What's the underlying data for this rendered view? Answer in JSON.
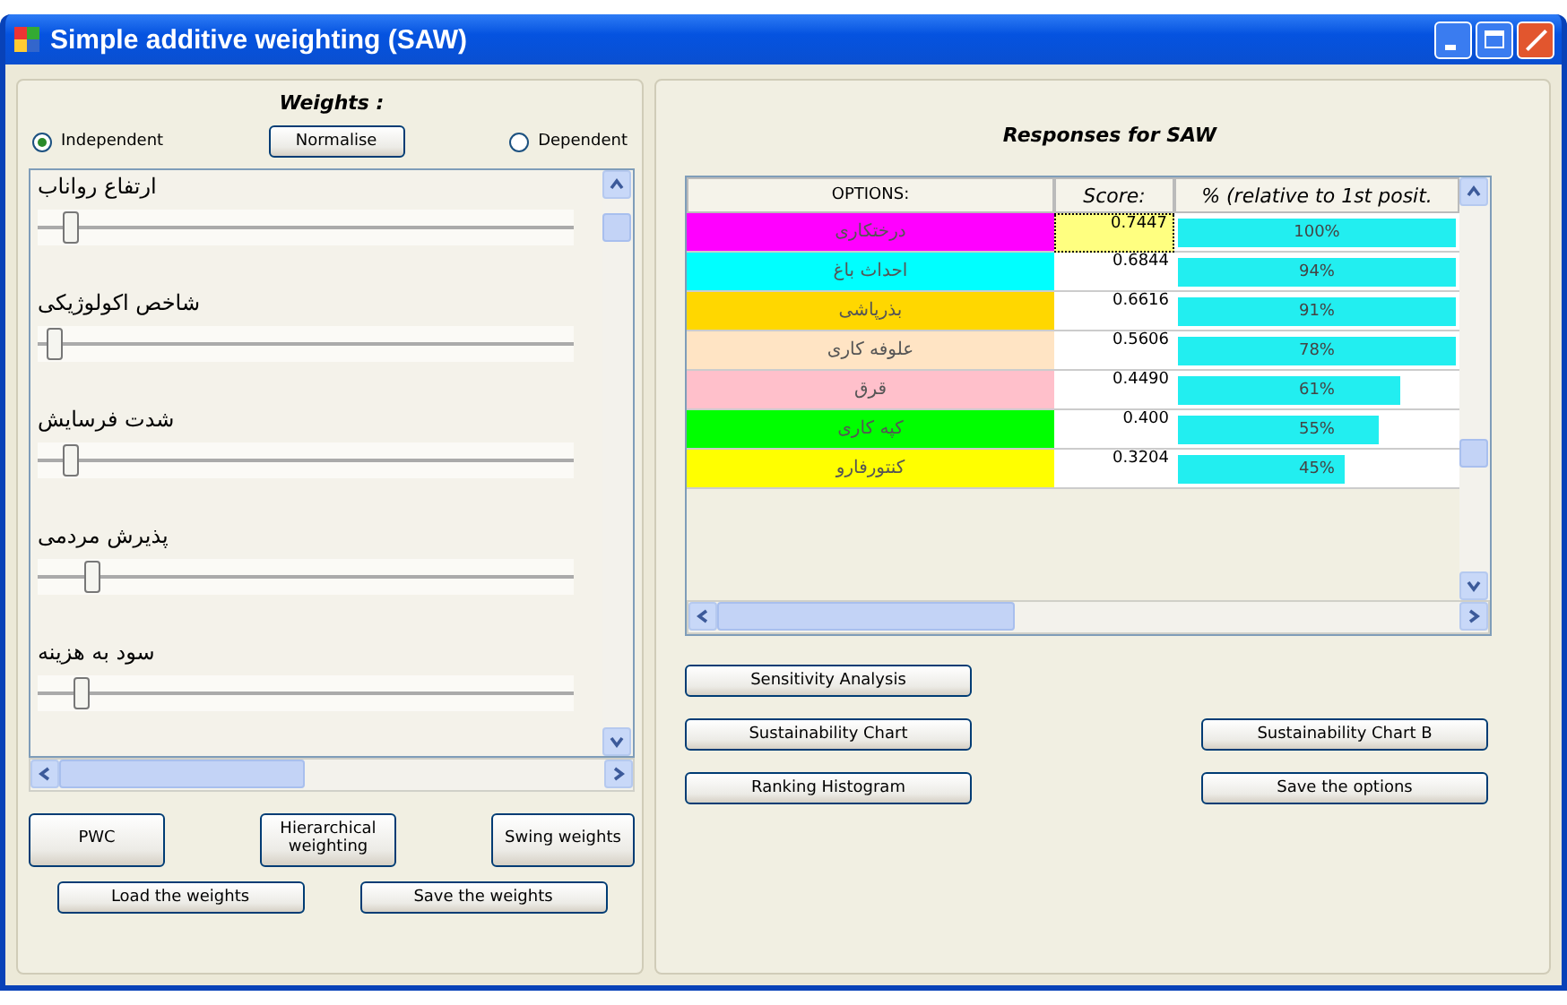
{
  "window": {
    "title": "Simple additive weighting (SAW)"
  },
  "weights": {
    "title": "Weights :",
    "modes": [
      {
        "label": "Independent",
        "selected": true
      },
      {
        "label": "Dependent",
        "selected": false
      }
    ],
    "normalise_button": "Normalise",
    "criteria": [
      {
        "label": "ارتفاع رواناب",
        "level": 0.06
      },
      {
        "label": "شاخص اکولوژیکی",
        "level": 0.03
      },
      {
        "label": "شدت فرسایش",
        "level": 0.06
      },
      {
        "label": "پذیرش مردمی",
        "level": 0.1
      },
      {
        "label": "سود به هزینه",
        "level": 0.08
      }
    ],
    "buttons": [
      "PWC",
      "Hierarchical weighting",
      "Swing weights"
    ],
    "file_buttons": [
      "Load the weights",
      "Save the weights"
    ]
  },
  "responses": {
    "title": "Responses for SAW",
    "table": {
      "columns": [
        "OPTIONS:",
        "Score:",
        "% (relative to 1st posit."
      ],
      "rows": [
        {
          "option": "درختکاری",
          "color": "#ff00ff",
          "score": "0.7447",
          "focused": true,
          "percent": "100%",
          "level": 1
        },
        {
          "option": "احداث باغ",
          "color": "#00ffff",
          "score": "0.6844",
          "focused": false,
          "percent": "94%",
          "level": 1
        },
        {
          "option": "بذرپاشی",
          "color": "#ffd700",
          "score": "0.6616",
          "focused": false,
          "percent": "91%",
          "level": 1
        },
        {
          "option": "علوفه کاری",
          "color": "#ffe4c4",
          "score": "0.5606",
          "focused": false,
          "percent": "78%",
          "level": 1
        },
        {
          "option": "قرق",
          "color": "#ffc0cb",
          "score": "0.4490",
          "focused": false,
          "percent": "61%",
          "level": 0.8
        },
        {
          "option": "کپه کاری",
          "color": "#00ff00",
          "score": "0.400",
          "focused": false,
          "percent": "55%",
          "level": 0.72
        },
        {
          "option": "کنتورفارو",
          "color": "#ffff00",
          "score": "0.3204",
          "focused": false,
          "percent": "45%",
          "level": 0.6
        }
      ]
    },
    "button_rows": [
      [
        "Sensitivity Analysis"
      ],
      [
        "Sustainability Chart",
        "Sustainability Chart B"
      ],
      [
        "Ranking Histogram",
        "Save the options"
      ]
    ]
  }
}
